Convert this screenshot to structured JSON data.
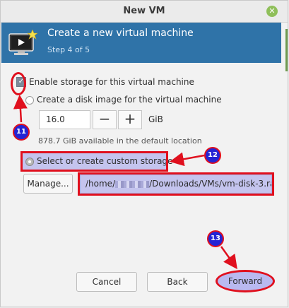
{
  "window": {
    "title": "New VM",
    "close_glyph": "✕"
  },
  "banner": {
    "title": "Create a new virtual machine",
    "step": "Step 4 of 5",
    "icon": "monitor-star-icon"
  },
  "storage": {
    "enable_label": "Enable storage for this virtual machine",
    "enable_checked": true,
    "create_disk_label": "Create a disk image for the virtual machine",
    "size_value": "16.0",
    "minus": "−",
    "plus": "+",
    "unit": "GiB",
    "available": "878.7 GiB available in the default location",
    "custom_label": "Select or create custom storage",
    "manage_label": "Manage...",
    "path_prefix": "/home/",
    "path_suffix": "/Downloads/VMs/vm-disk-3.ra"
  },
  "annotations": {
    "badge_11": "11",
    "badge_12": "12",
    "badge_13": "13",
    "color": "#e0101e"
  },
  "footer": {
    "cancel": "Cancel",
    "back": "Back",
    "forward": "Forward"
  }
}
